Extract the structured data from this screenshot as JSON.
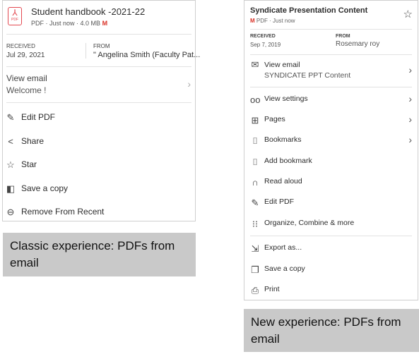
{
  "classic": {
    "file": {
      "title": "Student handbook -2021-22",
      "type": "PDF",
      "time": "Just now",
      "size": "4.0 MB",
      "icon_label": "PDF"
    },
    "received_label": "RECEIVED",
    "received_value": "Jul 29, 2021",
    "from_label": "FROM",
    "from_value": "\" Angelina Smith (Faculty Pat...",
    "view_email": {
      "label": "View email",
      "subject": "Welcome !"
    },
    "menu": [
      {
        "label": "Edit PDF",
        "icon": "pencil-icon"
      },
      {
        "label": "Share",
        "icon": "share-icon"
      },
      {
        "label": "Star",
        "icon": "star-icon"
      },
      {
        "label": "Save a copy",
        "icon": "save-copy-icon"
      },
      {
        "label": "Remove From Recent",
        "icon": "remove-icon"
      }
    ],
    "caption": "Classic experience: PDFs from email"
  },
  "new": {
    "file": {
      "title": "Syndicate Presentation Content",
      "type": "PDF",
      "time": "Just now"
    },
    "received_label": "RECEIVED",
    "received_value": "Sep 7, 2019",
    "from_label": "FROM",
    "from_value": "Rosemary roy",
    "view_email": {
      "label": "View email",
      "subject": "SYNDICATE PPT Content"
    },
    "menu": [
      {
        "label": "View settings",
        "icon": "glasses-icon"
      },
      {
        "label": "Pages",
        "icon": "grid-icon"
      },
      {
        "label": "Bookmarks",
        "icon": "bookmarks-icon"
      },
      {
        "label": "Add bookmark",
        "icon": "add-bookmark-icon"
      },
      {
        "label": "Read aloud",
        "icon": "headphones-icon"
      },
      {
        "label": "Edit PDF",
        "icon": "edit-icon"
      },
      {
        "label": "Organize, Combine & more",
        "icon": "dots-grid-icon"
      },
      {
        "label": "Export as...",
        "icon": "export-icon"
      },
      {
        "label": "Save a copy",
        "icon": "copy-icon"
      },
      {
        "label": "Print",
        "icon": "print-icon"
      }
    ],
    "caption": "New experience: PDFs from email"
  },
  "colors": {
    "pdf_red": "#e34850",
    "caption_bg": "#c9c9c9"
  }
}
